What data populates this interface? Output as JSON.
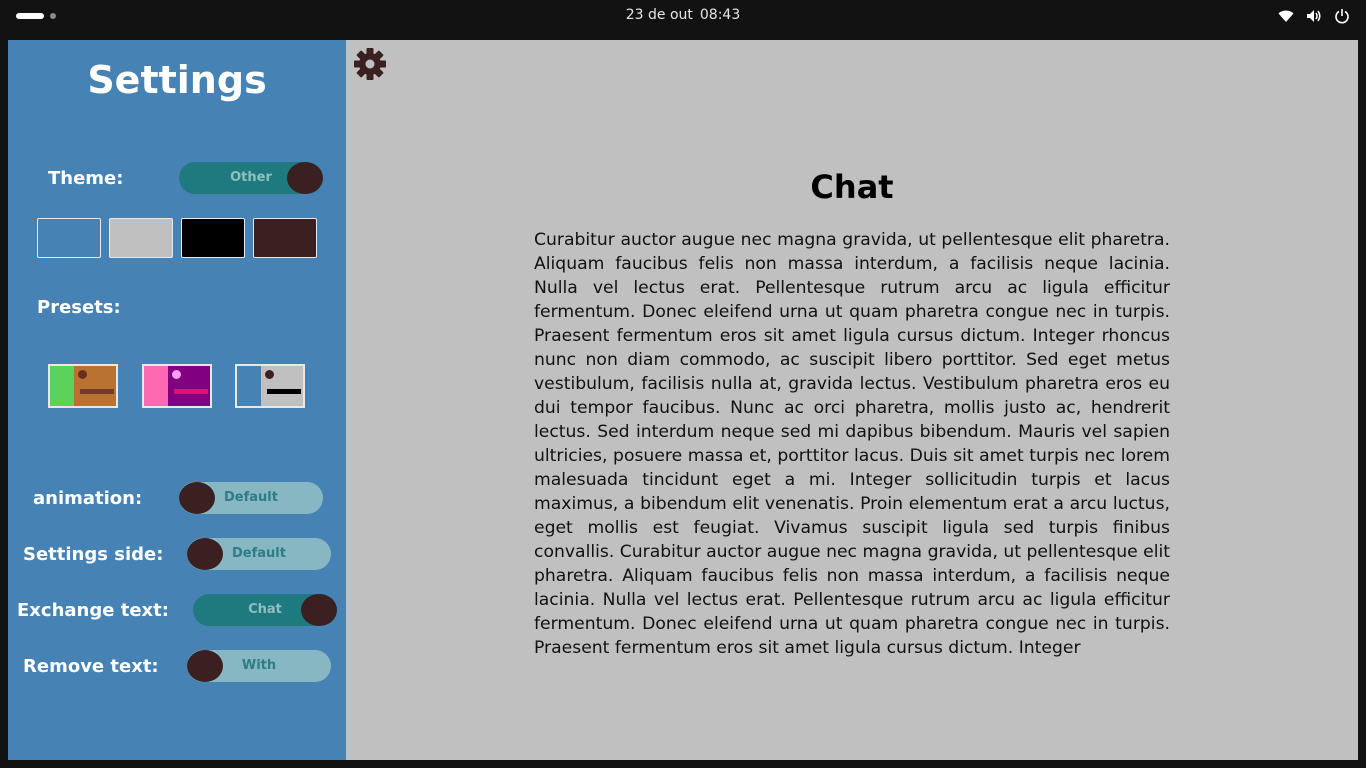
{
  "topbar": {
    "date": "23 de out",
    "time": "08:43"
  },
  "sidebar": {
    "title": "Settings",
    "theme": {
      "label": "Theme:",
      "toggle_text": "Other"
    },
    "swatches": [
      {
        "name": "steelblue",
        "color": "#4682b4"
      },
      {
        "name": "silver",
        "color": "#c0c0c0"
      },
      {
        "name": "black",
        "color": "#000000"
      },
      {
        "name": "dark-brown",
        "color": "#3a2020"
      }
    ],
    "presets_label": "Presets:",
    "presets": [
      {
        "strip": "#5bd35b",
        "body": "#b87333",
        "dot": "#6b2e1e",
        "bar": "#7a3a2a"
      },
      {
        "strip": "#ff69b4",
        "body": "#800080",
        "dot": "#ff9ff3",
        "bar": "#e0107a"
      },
      {
        "strip": "#4682b4",
        "body": "#c0c0c0",
        "dot": "#3a2020",
        "bar": "#000000"
      }
    ],
    "animation": {
      "label": "animation:",
      "toggle_text": "Default"
    },
    "settings_side": {
      "label": "Settings side:",
      "toggle_text": "Default"
    },
    "exchange_text": {
      "label": "Exchange text:",
      "toggle_text": "Chat"
    },
    "remove_text": {
      "label": "Remove text:",
      "toggle_text": "With"
    }
  },
  "main": {
    "title": "Chat",
    "body": "Curabitur auctor augue nec magna gravida, ut pellentesque elit pharetra. Aliquam faucibus felis non massa interdum, a facilisis neque lacinia. Nulla vel lectus erat. Pellentesque rutrum arcu ac ligula efficitur fermentum. Donec eleifend urna ut quam pharetra congue nec in turpis. Praesent fermentum eros sit amet ligula cursus dictum. Integer rhoncus nunc non diam commodo, ac suscipit libero porttitor. Sed eget metus vestibulum, facilisis nulla at, gravida lectus. Vestibulum pharetra eros eu dui tempor faucibus. Nunc ac orci pharetra, mollis justo ac, hendrerit lectus. Sed interdum neque sed mi dapibus bibendum. Mauris vel sapien ultricies, posuere massa et, porttitor lacus. Duis sit amet turpis nec lorem malesuada tincidunt eget a mi. Integer sollicitudin turpis et lacus maximus, a bibendum elit venenatis. Proin elementum erat a arcu luctus, eget mollis est feugiat. Vivamus suscipit ligula sed turpis finibus convallis. Curabitur auctor augue nec magna gravida, ut pellentesque elit pharetra. Aliquam faucibus felis non massa interdum, a facilisis neque lacinia. Nulla vel lectus erat. Pellentesque rutrum arcu ac ligula efficitur fermentum. Donec eleifend urna ut quam pharetra congue nec in turpis. Praesent fermentum eros sit amet ligula cursus dictum. Integer"
  },
  "icons": {
    "settings": "gear-icon",
    "wifi": "wifi-icon",
    "volume": "volume-icon",
    "power": "power-icon"
  },
  "colors": {
    "sidebar_bg": "#4682b4",
    "main_bg": "#c0c0c0",
    "toggle_on": "#1f7a80",
    "toggle_off": "#87b7c2",
    "knob": "#3a2020"
  }
}
